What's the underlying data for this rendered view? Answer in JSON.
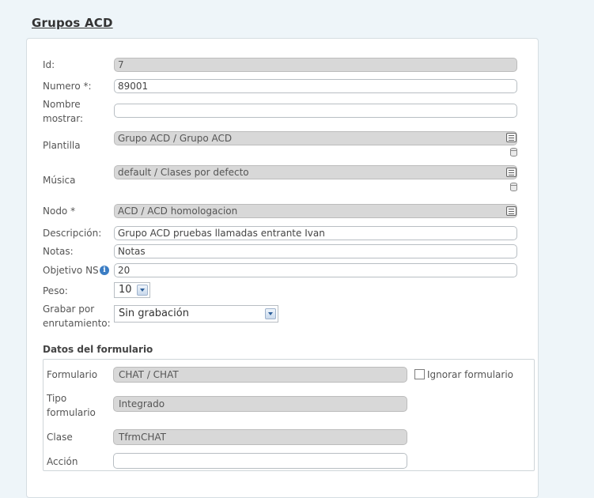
{
  "page": {
    "title": "Grupos ACD"
  },
  "form": {
    "id": {
      "label": "Id:",
      "value": "7"
    },
    "numero": {
      "label": "Numero *:",
      "value": "89001"
    },
    "nombre": {
      "label_line1": "Nombre",
      "label_line2": "mostrar:",
      "value": ""
    },
    "plantilla": {
      "label": "Plantilla",
      "value": "Grupo ACD / Grupo ACD",
      "icon": "list-icon",
      "icon2": "database-icon"
    },
    "musica": {
      "label": "Música",
      "value": "default / Clases por defecto",
      "icon": "list-icon",
      "icon2": "database-icon"
    },
    "nodo": {
      "label": "Nodo *",
      "value": "ACD / ACD homologacion",
      "icon": "list-icon"
    },
    "descripcion": {
      "label": "Descripción:",
      "value": "Grupo ACD pruebas llamadas entrante Ivan"
    },
    "notas": {
      "label": "Notas:",
      "value": "Notas"
    },
    "objetivo": {
      "label": "Objetivo NS",
      "value": "20",
      "info": "i"
    },
    "peso": {
      "label": "Peso:",
      "value": "10"
    },
    "grabar": {
      "label_line1": "Grabar por",
      "label_line2": "enrutamiento:",
      "value": "Sin grabación"
    }
  },
  "formulario_section": {
    "title": "Datos del formulario",
    "formulario": {
      "label": "Formulario",
      "value": "CHAT / CHAT"
    },
    "ignorar": {
      "label": "Ignorar formulario",
      "checked": false
    },
    "tipo": {
      "label_line1": "Tipo",
      "label_line2": "formulario",
      "value": "Integrado"
    },
    "clase": {
      "label": "Clase",
      "value": "TfrmCHAT"
    },
    "accion": {
      "label": "Acción",
      "value": ""
    }
  }
}
